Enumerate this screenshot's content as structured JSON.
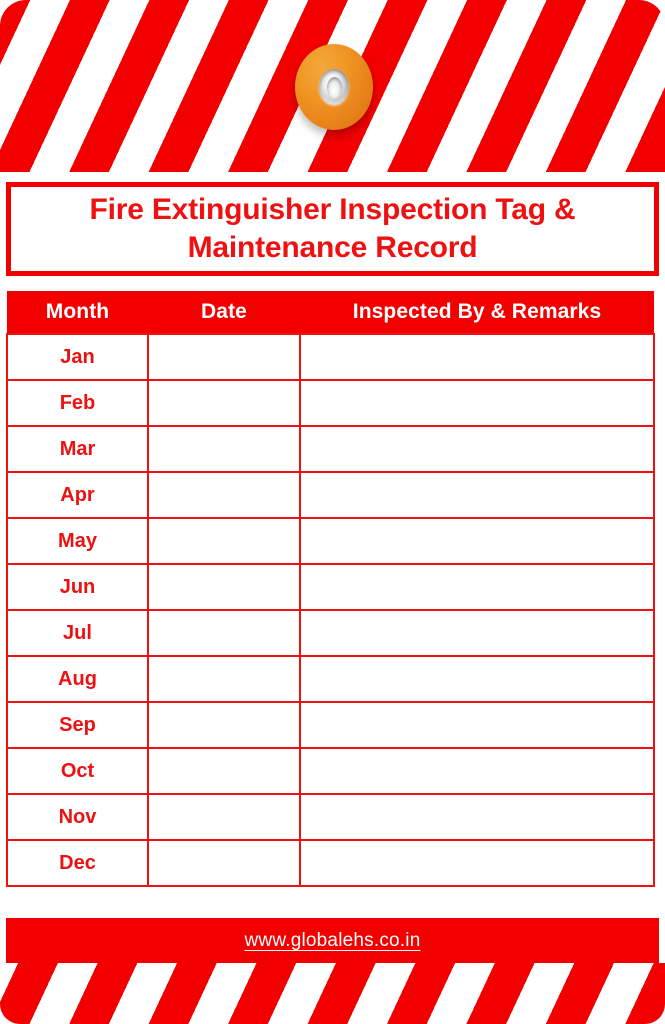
{
  "document": {
    "kind": "fire-extinguisher-inspection-tag",
    "title": "Fire Extinguisher Inspection Tag & Maintenance Record"
  },
  "colors": {
    "red": "#f20000",
    "title_red": "#ee1111",
    "white": "#ffffff",
    "grommet_orange": "#ef9422",
    "grommet_metal": "#cfcfcf"
  },
  "hardware": {
    "grommet_label": "tag-eyelet",
    "hole_label": "tag-hole"
  },
  "table": {
    "headers": [
      "Month",
      "Date",
      "Inspected By & Remarks"
    ],
    "rows": [
      {
        "month": "Jan",
        "date": "",
        "inspected_by": ""
      },
      {
        "month": "Feb",
        "date": "",
        "inspected_by": ""
      },
      {
        "month": "Mar",
        "date": "",
        "inspected_by": ""
      },
      {
        "month": "Apr",
        "date": "",
        "inspected_by": ""
      },
      {
        "month": "May",
        "date": "",
        "inspected_by": ""
      },
      {
        "month": "Jun",
        "date": "",
        "inspected_by": ""
      },
      {
        "month": "Jul",
        "date": "",
        "inspected_by": ""
      },
      {
        "month": "Aug",
        "date": "",
        "inspected_by": ""
      },
      {
        "month": "Sep",
        "date": "",
        "inspected_by": ""
      },
      {
        "month": "Oct",
        "date": "",
        "inspected_by": ""
      },
      {
        "month": "Nov",
        "date": "",
        "inspected_by": ""
      },
      {
        "month": "Dec",
        "date": "",
        "inspected_by": ""
      }
    ]
  },
  "footer": {
    "url": "www.globalehs.co.in"
  }
}
